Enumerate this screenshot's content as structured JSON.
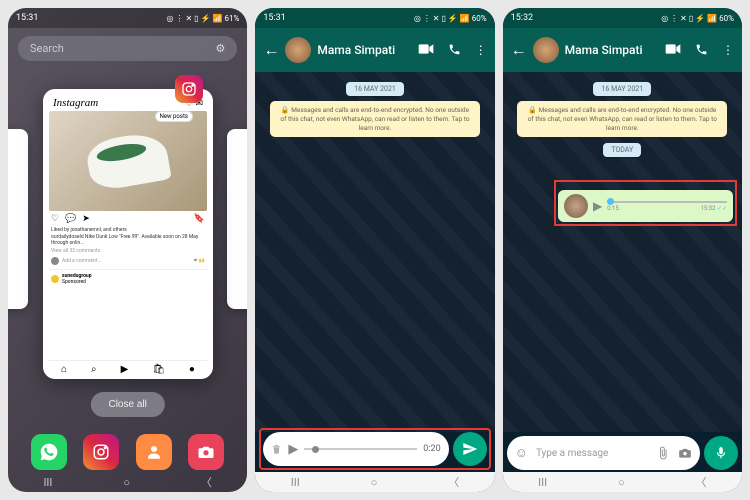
{
  "phone1": {
    "time": "15:31",
    "battery": "61%",
    "search_placeholder": "Search",
    "instagram": {
      "logo": "Instagram",
      "new_posts": "New posts",
      "likes": "Liked by jonathanemnl, and others",
      "caption": "ourdailydoseId Nike Dunk Low \"Free.99\". Available soon on 28 May through onlin...",
      "comments": "View all 32 comments",
      "add_comment": "Add a comment...",
      "sponsored_user": "sunedugroup",
      "sponsored_label": "Sponsored"
    },
    "close_all": "Close all"
  },
  "phone2": {
    "time": "15:31",
    "battery": "60%",
    "contact": "Mama Simpati",
    "date": "16 MAY 2021",
    "encrypt": "Messages and calls are end-to-end encrypted. No one outside of this chat, not even WhatsApp, can read or listen to them. Tap to learn more.",
    "rec_time": "0:20"
  },
  "phone3": {
    "time": "15:32",
    "battery": "60%",
    "contact": "Mama Simpati",
    "date": "16 MAY 2021",
    "encrypt": "Messages and calls are end-to-end encrypted. No one outside of this chat, not even WhatsApp, can read or listen to them. Tap to learn more.",
    "today": "TODAY",
    "vm_duration": "0:15",
    "vm_time": "15:32",
    "input_placeholder": "Type a message"
  }
}
